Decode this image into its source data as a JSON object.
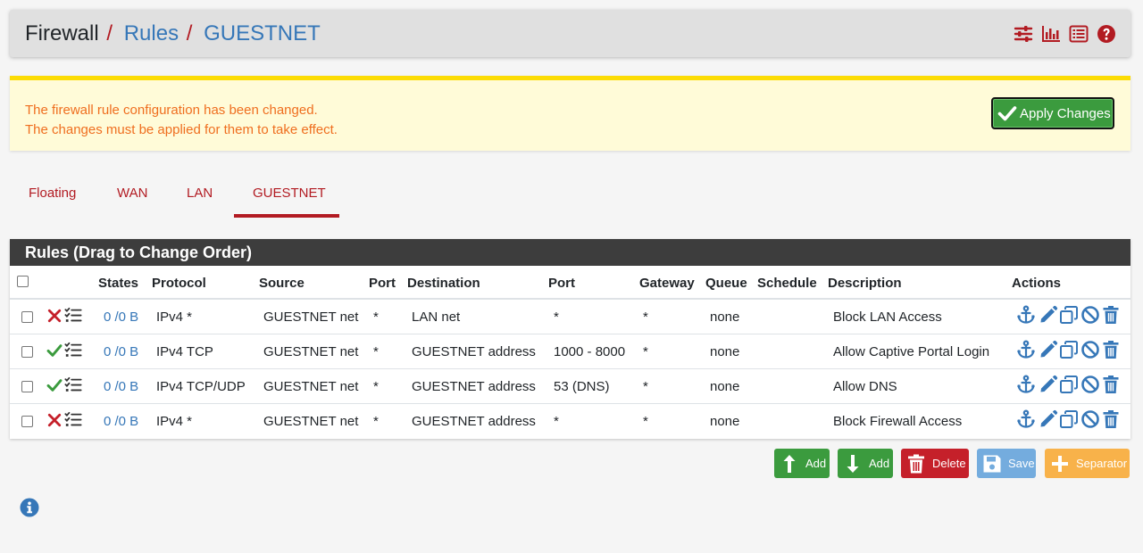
{
  "header": {
    "breadcrumb": [
      "Firewall",
      "Rules",
      "GUESTNET"
    ],
    "separator": "/",
    "icons": [
      "sliders-icon",
      "bar-chart-icon",
      "list-icon",
      "help-icon"
    ]
  },
  "alert": {
    "line1": "The firewall rule configuration has been changed.",
    "line2": "The changes must be applied for them to take effect.",
    "apply_label": "Apply Changes"
  },
  "tabs": [
    {
      "label": "Floating",
      "active": false
    },
    {
      "label": "WAN",
      "active": false
    },
    {
      "label": "LAN",
      "active": false
    },
    {
      "label": "GUESTNET",
      "active": true
    }
  ],
  "panel": {
    "title": "Rules (Drag to Change Order)",
    "columns": [
      "States",
      "Protocol",
      "Source",
      "Port",
      "Destination",
      "Port",
      "Gateway",
      "Queue",
      "Schedule",
      "Description",
      "Actions"
    ]
  },
  "rules": [
    {
      "action": "block",
      "states": "0 /0 B",
      "protocol": "IPv4 *",
      "source": "GUESTNET net",
      "source_port": "*",
      "destination": "LAN net",
      "dest_port": "*",
      "gateway": "*",
      "queue": "none",
      "schedule": "",
      "description": "Block LAN Access"
    },
    {
      "action": "pass",
      "states": "0 /0 B",
      "protocol": "IPv4 TCP",
      "source": "GUESTNET net",
      "source_port": "*",
      "destination": "GUESTNET address",
      "dest_port": "1000 - 8000",
      "gateway": "*",
      "queue": "none",
      "schedule": "",
      "description": "Allow Captive Portal Login"
    },
    {
      "action": "pass",
      "states": "0 /0 B",
      "protocol": "IPv4 TCP/UDP",
      "source": "GUESTNET net",
      "source_port": "*",
      "destination": "GUESTNET address",
      "dest_port": "53 (DNS)",
      "gateway": "*",
      "queue": "none",
      "schedule": "",
      "description": "Allow DNS"
    },
    {
      "action": "block",
      "states": "0 /0 B",
      "protocol": "IPv4 *",
      "source": "GUESTNET net",
      "source_port": "*",
      "destination": "GUESTNET address",
      "dest_port": "*",
      "gateway": "*",
      "queue": "none",
      "schedule": "",
      "description": "Block Firewall Access"
    }
  ],
  "buttons": {
    "add_top": "Add",
    "add_bottom": "Add",
    "delete": "Delete",
    "save": "Save",
    "separator": "Separator"
  },
  "colors": {
    "brand_red": "#b21b22",
    "link_blue": "#3677b8",
    "success_green": "#3b9b3e",
    "alert_text": "#ef6e1f",
    "alert_bg": "#fffbd8",
    "panel_head": "#3d3d3d"
  }
}
